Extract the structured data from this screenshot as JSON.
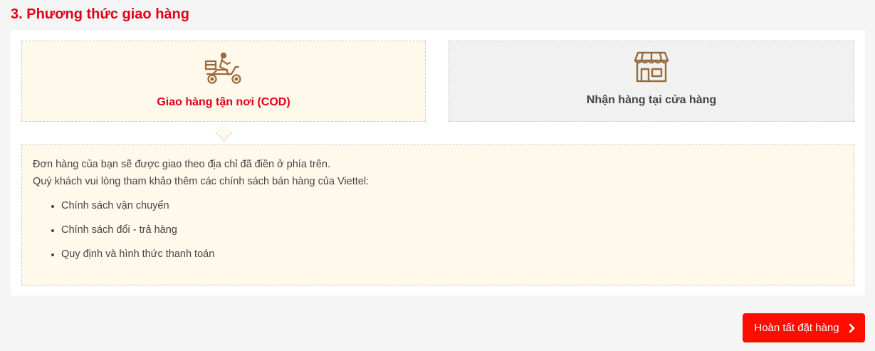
{
  "section": {
    "title": "3. Phương thức giao hàng"
  },
  "shipping_options": [
    {
      "label": "Giao hàng tận nơi (COD)",
      "icon": "delivery-scooter-icon",
      "selected": true
    },
    {
      "label": "Nhận hàng tại cửa hàng",
      "icon": "storefront-icon",
      "selected": false
    }
  ],
  "info": {
    "line1": "Đơn hàng của bạn sẽ được giao theo địa chỉ đã điền ở phía trên.",
    "line2": "Quý khách vui lòng tham khảo thêm các chính sách bán hàng của Viettel:",
    "policies": [
      "Chính sách vận chuyển",
      "Chính sách đổi - trả hàng",
      "Quy định và hình thức thanh toán"
    ]
  },
  "actions": {
    "complete_label": "Hoàn tất đặt hàng",
    "complete_icon": "chevron-right-icon"
  },
  "colors": {
    "accent": "#e0001a",
    "button": "#ff0d00",
    "icon_brown": "#9a6a3a",
    "selected_bg": "#fff9ec"
  }
}
